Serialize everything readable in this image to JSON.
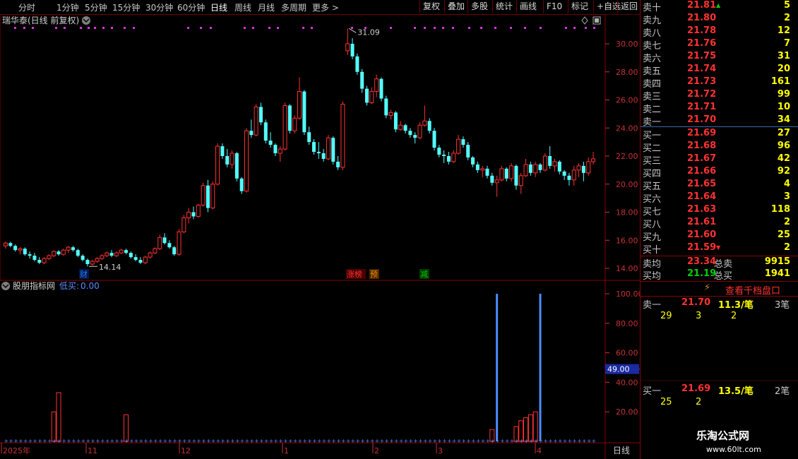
{
  "toolbar": {
    "periods": [
      "分时",
      "1分钟",
      "5分钟",
      "15分钟",
      "30分钟",
      "60分钟",
      "日线",
      "周线",
      "月线",
      "多周期",
      "更多 >"
    ],
    "active_period": "日线",
    "buttons": [
      "复权",
      "叠加",
      "多股",
      "统计",
      "画线",
      "F10",
      "标记",
      "+自选",
      "返回"
    ]
  },
  "main_chart": {
    "title": "瑞华泰(日线 前复权)",
    "high_label": "31.09",
    "low_label": "14.14",
    "y_ticks": [
      "30.00",
      "28.00",
      "26.00",
      "24.00",
      "22.00",
      "20.00",
      "18.00",
      "16.00",
      "14.00"
    ],
    "event_tags": [
      {
        "text": "财",
        "color": "#2878ff"
      },
      {
        "text": "涨榜",
        "color": "#ff3232"
      },
      {
        "text": "预",
        "color": "#ff8800"
      },
      {
        "text": "减",
        "color": "#00c800"
      }
    ]
  },
  "indicator": {
    "name": "股朋指标网",
    "label": "低买:",
    "value": "0.00",
    "y_ticks": [
      "100.00",
      "80.00",
      "60.00",
      "40.00",
      "20.00"
    ],
    "cursor_value": "49.00"
  },
  "x_axis": {
    "labels": [
      "2025年",
      "11",
      "12",
      "1",
      "2",
      "3",
      "4"
    ],
    "period_label": "日线"
  },
  "chart_data": [
    {
      "type": "candlestick",
      "title": "瑞华泰(日线 前复权)",
      "y_range": [
        13.6,
        31.6
      ],
      "up_color": "#ff3232",
      "down_color": "#54ffff",
      "ohlc": [
        [
          15.6,
          15.9,
          15.4,
          15.8
        ],
        [
          15.8,
          15.9,
          15.5,
          15.6
        ],
        [
          15.6,
          15.7,
          15.2,
          15.3
        ],
        [
          15.3,
          15.5,
          15.0,
          15.4
        ],
        [
          15.4,
          15.5,
          14.9,
          15.0
        ],
        [
          15.0,
          15.2,
          14.7,
          14.9
        ],
        [
          14.9,
          15.1,
          14.5,
          14.6
        ],
        [
          14.6,
          14.8,
          14.3,
          14.4
        ],
        [
          14.4,
          14.8,
          14.3,
          14.7
        ],
        [
          14.7,
          15.0,
          14.6,
          14.9
        ],
        [
          14.9,
          15.3,
          14.8,
          15.2
        ],
        [
          15.2,
          15.3,
          14.9,
          15.0
        ],
        [
          15.0,
          15.4,
          14.9,
          15.3
        ],
        [
          15.3,
          15.6,
          15.1,
          15.5
        ],
        [
          15.5,
          15.6,
          15.2,
          15.3
        ],
        [
          15.3,
          15.4,
          14.8,
          14.9
        ],
        [
          14.9,
          15.0,
          14.5,
          14.6
        ],
        [
          14.6,
          14.7,
          14.14,
          14.3
        ],
        [
          14.3,
          14.6,
          14.2,
          14.5
        ],
        [
          14.5,
          14.8,
          14.4,
          14.7
        ],
        [
          14.7,
          15.0,
          14.6,
          14.9
        ],
        [
          14.9,
          15.2,
          14.8,
          15.1
        ],
        [
          15.1,
          15.3,
          14.8,
          14.9
        ],
        [
          14.9,
          15.2,
          14.8,
          15.1
        ],
        [
          15.1,
          15.4,
          15.0,
          15.3
        ],
        [
          15.3,
          15.4,
          15.0,
          15.1
        ],
        [
          15.1,
          15.2,
          14.7,
          14.8
        ],
        [
          14.8,
          15.0,
          14.5,
          14.6
        ],
        [
          14.6,
          14.8,
          14.3,
          14.4
        ],
        [
          14.4,
          14.9,
          14.3,
          14.8
        ],
        [
          14.8,
          15.2,
          14.7,
          15.1
        ],
        [
          15.1,
          15.5,
          15.0,
          15.4
        ],
        [
          15.4,
          16.4,
          15.3,
          16.2
        ],
        [
          16.2,
          16.5,
          15.7,
          15.8
        ],
        [
          15.8,
          16.0,
          15.4,
          15.5
        ],
        [
          15.5,
          15.6,
          14.9,
          15.0
        ],
        [
          15.0,
          16.8,
          14.9,
          16.6
        ],
        [
          16.6,
          17.8,
          16.5,
          17.6
        ],
        [
          17.6,
          18.3,
          17.2,
          18.0
        ],
        [
          18.0,
          18.4,
          17.5,
          17.7
        ],
        [
          17.7,
          18.6,
          17.6,
          18.5
        ],
        [
          18.5,
          20.1,
          18.4,
          19.9
        ],
        [
          19.9,
          20.3,
          18.0,
          18.3
        ],
        [
          18.3,
          20.2,
          18.2,
          20.0
        ],
        [
          20.0,
          22.9,
          19.9,
          22.7
        ],
        [
          22.7,
          22.9,
          21.8,
          22.0
        ],
        [
          22.0,
          22.5,
          21.2,
          21.4
        ],
        [
          21.4,
          22.4,
          21.1,
          22.2
        ],
        [
          22.2,
          22.3,
          20.2,
          20.4
        ],
        [
          20.4,
          20.5,
          19.3,
          19.5
        ],
        [
          19.5,
          24.0,
          19.4,
          23.8
        ],
        [
          23.8,
          24.6,
          23.3,
          23.5
        ],
        [
          23.5,
          25.7,
          23.4,
          25.5
        ],
        [
          25.5,
          25.8,
          24.2,
          24.4
        ],
        [
          24.4,
          24.6,
          22.9,
          23.1
        ],
        [
          23.1,
          23.7,
          22.6,
          22.8
        ],
        [
          22.8,
          22.9,
          22.0,
          22.2
        ],
        [
          22.2,
          22.7,
          21.6,
          22.5
        ],
        [
          22.5,
          25.8,
          22.4,
          25.6
        ],
        [
          25.6,
          25.7,
          23.6,
          23.8
        ],
        [
          23.8,
          24.9,
          23.6,
          24.7
        ],
        [
          24.7,
          27.6,
          24.6,
          26.6
        ],
        [
          26.6,
          26.7,
          23.5,
          23.7
        ],
        [
          23.7,
          24.1,
          22.8,
          23.0
        ],
        [
          23.0,
          23.2,
          22.1,
          22.3
        ],
        [
          22.3,
          23.0,
          21.8,
          22.2
        ],
        [
          22.2,
          22.5,
          21.6,
          21.8
        ],
        [
          21.8,
          23.5,
          21.7,
          23.3
        ],
        [
          23.3,
          23.4,
          21.4,
          21.6
        ],
        [
          21.6,
          22.0,
          21.0,
          21.2
        ],
        [
          21.2,
          25.9,
          21.0,
          25.7
        ],
        [
          29.5,
          31.09,
          29.2,
          30.0
        ],
        [
          30.0,
          30.4,
          28.9,
          29.1
        ],
        [
          29.1,
          29.3,
          27.8,
          28.0
        ],
        [
          28.0,
          28.2,
          26.5,
          26.8
        ],
        [
          26.8,
          27.0,
          25.6,
          25.8
        ],
        [
          25.8,
          26.9,
          25.7,
          26.6
        ],
        [
          26.6,
          27.8,
          26.2,
          27.5
        ],
        [
          27.5,
          27.6,
          25.9,
          26.1
        ],
        [
          26.1,
          26.3,
          24.7,
          24.9
        ],
        [
          24.9,
          25.3,
          24.6,
          25.1
        ],
        [
          25.1,
          25.2,
          23.7,
          23.9
        ],
        [
          23.9,
          24.5,
          23.8,
          24.2
        ],
        [
          24.2,
          24.3,
          23.6,
          23.8
        ],
        [
          23.8,
          24.0,
          23.3,
          23.5
        ],
        [
          23.5,
          23.7,
          22.9,
          23.3
        ],
        [
          23.3,
          24.4,
          23.2,
          24.2
        ],
        [
          24.2,
          25.6,
          24.1,
          24.5
        ],
        [
          24.5,
          24.7,
          23.6,
          23.8
        ],
        [
          23.8,
          24.0,
          22.4,
          22.6
        ],
        [
          22.6,
          22.8,
          21.9,
          22.1
        ],
        [
          22.1,
          22.4,
          21.5,
          22.0
        ],
        [
          22.0,
          22.3,
          21.4,
          21.6
        ],
        [
          21.6,
          22.4,
          21.5,
          22.2
        ],
        [
          22.2,
          23.5,
          22.1,
          23.2
        ],
        [
          23.2,
          23.4,
          22.6,
          22.8
        ],
        [
          22.8,
          23.0,
          21.7,
          21.9
        ],
        [
          21.9,
          22.0,
          21.2,
          21.4
        ],
        [
          21.4,
          21.6,
          20.8,
          21.0
        ],
        [
          21.0,
          21.3,
          20.5,
          21.1
        ],
        [
          21.1,
          21.3,
          20.4,
          20.6
        ],
        [
          20.6,
          20.8,
          19.9,
          20.1
        ],
        [
          20.1,
          20.6,
          19.1,
          20.3
        ],
        [
          20.3,
          21.3,
          20.2,
          21.1
        ],
        [
          21.1,
          21.2,
          20.2,
          20.4
        ],
        [
          20.4,
          21.5,
          20.2,
          21.3
        ],
        [
          21.3,
          21.4,
          19.6,
          19.9
        ],
        [
          19.9,
          20.8,
          19.3,
          20.6
        ],
        [
          20.6,
          21.8,
          20.5,
          21.4
        ],
        [
          21.4,
          21.6,
          20.6,
          20.8
        ],
        [
          20.8,
          21.6,
          20.5,
          21.4
        ],
        [
          21.4,
          21.5,
          20.8,
          21.0
        ],
        [
          21.0,
          22.2,
          20.9,
          22.0
        ],
        [
          22.0,
          22.7,
          21.1,
          21.3
        ],
        [
          21.3,
          21.8,
          20.9,
          21.6
        ],
        [
          21.6,
          21.7,
          20.7,
          20.9
        ],
        [
          20.9,
          21.0,
          20.3,
          20.6
        ],
        [
          20.6,
          20.8,
          19.9,
          20.3
        ],
        [
          20.3,
          21.3,
          19.9,
          21.0
        ],
        [
          21.0,
          21.5,
          20.5,
          21.3
        ],
        [
          21.3,
          21.6,
          20.2,
          20.8
        ],
        [
          20.8,
          21.9,
          20.6,
          21.6
        ],
        [
          21.6,
          22.3,
          21.4,
          21.8
        ]
      ]
    },
    {
      "type": "bar",
      "title": "股朋指标网",
      "y_range": [
        0,
        105
      ],
      "bars": [
        {
          "index": 10,
          "value": 20
        },
        {
          "index": 11,
          "value": 33
        },
        {
          "index": 25,
          "value": 18
        },
        {
          "index": 101,
          "value": 8
        },
        {
          "index": 106,
          "value": 10
        },
        {
          "index": 107,
          "value": 14
        },
        {
          "index": 108,
          "value": 16
        },
        {
          "index": 109,
          "value": 18
        },
        {
          "index": 110,
          "value": 20
        }
      ],
      "spikes": [
        {
          "index": 102,
          "value": 100
        },
        {
          "index": 111,
          "value": 100
        }
      ]
    }
  ],
  "orderbook": {
    "sells": [
      {
        "label": "卖十",
        "price": "21.81",
        "vol": "5",
        "mark": "up"
      },
      {
        "label": "卖九",
        "price": "21.80",
        "vol": "2"
      },
      {
        "label": "卖八",
        "price": "21.78",
        "vol": "12"
      },
      {
        "label": "卖七",
        "price": "21.76",
        "vol": "7"
      },
      {
        "label": "卖六",
        "price": "21.75",
        "vol": "31"
      },
      {
        "label": "卖五",
        "price": "21.74",
        "vol": "20"
      },
      {
        "label": "卖四",
        "price": "21.73",
        "vol": "161"
      },
      {
        "label": "卖三",
        "price": "21.72",
        "vol": "99"
      },
      {
        "label": "卖二",
        "price": "21.71",
        "vol": "10"
      },
      {
        "label": "卖一",
        "price": "21.70",
        "vol": "34"
      }
    ],
    "buys": [
      {
        "label": "买一",
        "price": "21.69",
        "vol": "27"
      },
      {
        "label": "买二",
        "price": "21.68",
        "vol": "96"
      },
      {
        "label": "买三",
        "price": "21.67",
        "vol": "42"
      },
      {
        "label": "买四",
        "price": "21.66",
        "vol": "92"
      },
      {
        "label": "买五",
        "price": "21.65",
        "vol": "4"
      },
      {
        "label": "买六",
        "price": "21.64",
        "vol": "3"
      },
      {
        "label": "买七",
        "price": "21.63",
        "vol": "118"
      },
      {
        "label": "买八",
        "price": "21.61",
        "vol": "2"
      },
      {
        "label": "买九",
        "price": "21.60",
        "vol": "25"
      },
      {
        "label": "买十",
        "price": "21.59",
        "vol": "2",
        "mark": "down"
      }
    ],
    "sell_avg": {
      "label": "卖均",
      "price": "23.34",
      "total_label": "总卖",
      "total": "9915"
    },
    "buy_avg": {
      "label": "买均",
      "price": "21.19",
      "total_label": "总买",
      "total": "1941"
    },
    "queue_button": "查看千档盘口",
    "sell_queue": {
      "label": "卖一",
      "price": "21.70",
      "avg": "11.3/笔",
      "count": "3笔",
      "items": [
        "29",
        "3",
        "2"
      ]
    },
    "buy_queue": {
      "label": "买一",
      "price": "21.69",
      "avg": "13.5/笔",
      "count": "2笔",
      "items": [
        "25",
        "2"
      ]
    }
  },
  "watermark": {
    "name": "乐淘公式网",
    "url": "www.60lt.com"
  }
}
